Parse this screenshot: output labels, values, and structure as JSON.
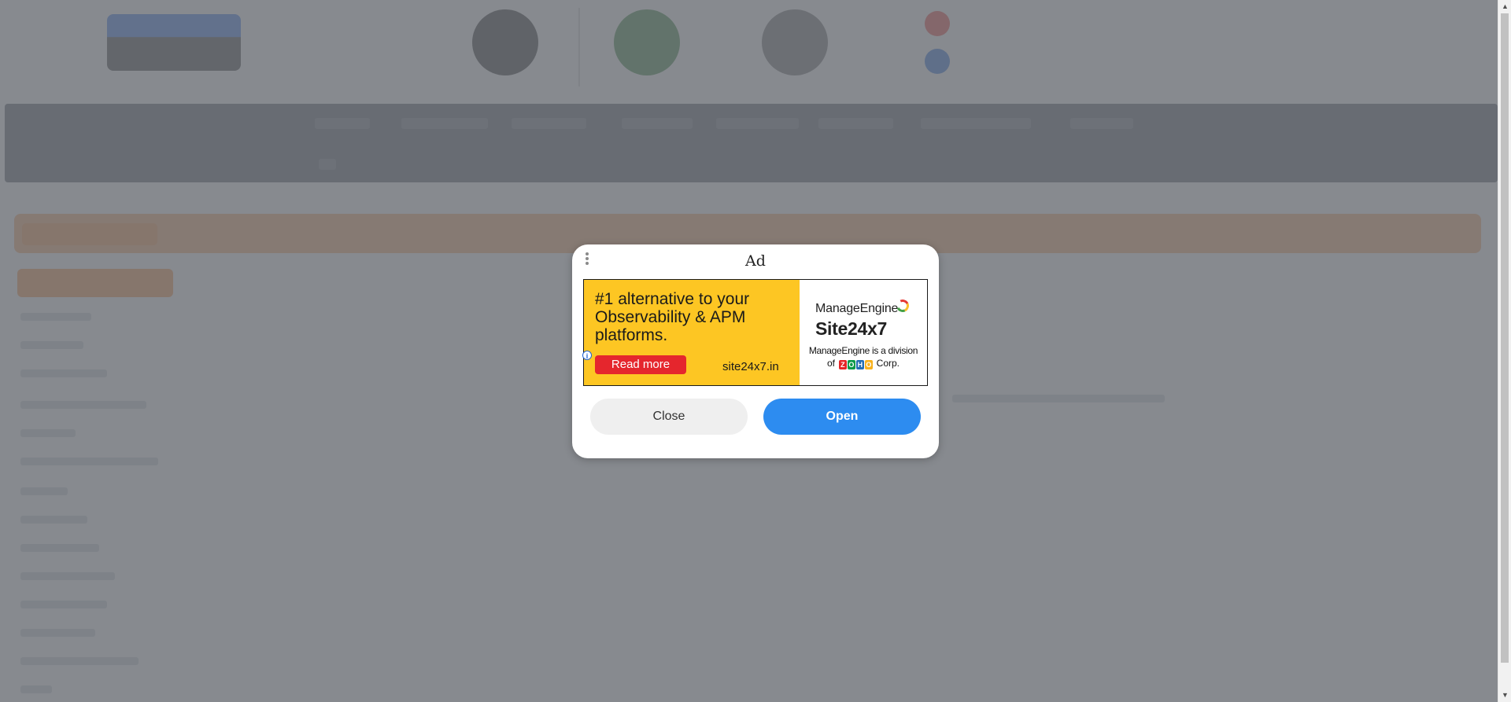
{
  "dialog": {
    "title": "Ad",
    "close_label": "Close",
    "open_label": "Open"
  },
  "ad": {
    "headline": "#1 alternative to your Observability & APM platforms.",
    "cta_label": "Read more",
    "url": "site24x7.in",
    "brand": "ManageEngine",
    "product": "Site24x7",
    "division_line1": "ManageEngine is a division",
    "division_prefix": "of",
    "zoho_letters": [
      "Z",
      "O",
      "H",
      "O"
    ],
    "division_suffix": "Corp.",
    "info_glyph": "i",
    "colors": {
      "panel": "#fdc623",
      "cta": "#e5262d"
    }
  },
  "scrollbar": {
    "up_glyph": "▲",
    "down_glyph": "▼"
  },
  "colors": {
    "open_button": "#2d8cf0",
    "overlay": "rgba(110,114,120,0.82)"
  }
}
